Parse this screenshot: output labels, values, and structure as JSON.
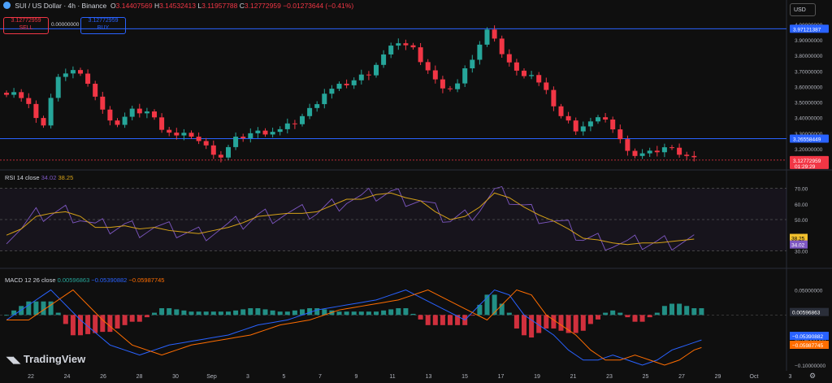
{
  "header": {
    "symbol": "SUI / US Dollar · 4h · Binance",
    "o_label": "O",
    "o_value": "3.14407569",
    "h_label": "H",
    "h_value": "3.14532413",
    "l_label": "L",
    "l_value": "3.11957788",
    "c_label": "C",
    "c_value": "3.12772959",
    "change": "−0.01273644 (−0.41%)"
  },
  "trade": {
    "sell_price": "3.12772959",
    "sell_label": "SELL",
    "spread": "0.00000000",
    "buy_price": "3.12772959",
    "buy_label": "BUY"
  },
  "currency": "USD",
  "rsi": {
    "label": "RSI 14 close",
    "value": "34.02",
    "ma_value": "38.25"
  },
  "macd": {
    "label": "MACD 12 26 close",
    "hist": "0.00596863",
    "macd": "−0.05390882",
    "signal": "−0.05987745"
  },
  "brand": "TradingView",
  "colors": {
    "up": "#26a69a",
    "down": "#f23645",
    "rsi": "#7e57c2",
    "rsi_ma": "#d4a017",
    "macd": "#2962ff",
    "signal": "#ff6d00"
  },
  "chart_data": {
    "type": "candlestick",
    "price_axis": {
      "ticks": [
        "4.00000000",
        "3.90000000",
        "3.80000000",
        "3.70000000",
        "3.60000000",
        "3.50000000",
        "3.40000000",
        "3.30000000",
        "3.20000000"
      ],
      "min": 3.08,
      "max": 4.02
    },
    "price_levels": [
      3.97121387,
      3.26558449
    ],
    "price_badges": [
      {
        "text": "3.97121387",
        "color": "#2962ff"
      },
      {
        "text": "3.26558449",
        "color": "#2962ff"
      },
      {
        "text": "3.12772959",
        "color": "#f23645",
        "sub": "01:29:29"
      }
    ],
    "rsi_axis": {
      "ticks": [
        "70.00",
        "60.00",
        "50.00",
        "40.00",
        "30.00"
      ],
      "min": 25,
      "max": 75,
      "badges": [
        {
          "text": "38.25",
          "color": "#f2c12e"
        },
        {
          "text": "34.02",
          "color": "#7e57c2"
        }
      ]
    },
    "macd_axis": {
      "ticks": [
        "0.05000000",
        "−0.05000000",
        "−0.10000000"
      ],
      "min": -0.105,
      "max": 0.085,
      "badges": [
        {
          "text": "0.00596863",
          "color": "#2a2e39"
        },
        {
          "text": "−0.05390882",
          "color": "#2962ff"
        },
        {
          "text": "−0.05987745",
          "color": "#ff6d00"
        }
      ]
    },
    "x_labels": [
      "22",
      "24",
      "26",
      "28",
      "30",
      "Sep",
      "3",
      "5",
      "7",
      "9",
      "11",
      "13",
      "15",
      "17",
      "19",
      "21",
      "23",
      "25",
      "27",
      "29",
      "Oct",
      "3"
    ],
    "price_path": [
      [
        0,
        3.56
      ],
      [
        2,
        3.57
      ],
      [
        4,
        3.47
      ],
      [
        6,
        3.35
      ],
      [
        8,
        3.68
      ],
      [
        10,
        3.7
      ],
      [
        12,
        3.63
      ],
      [
        14,
        3.44
      ],
      [
        16,
        3.36
      ],
      [
        18,
        3.44
      ],
      [
        20,
        3.44
      ],
      [
        22,
        3.34
      ],
      [
        24,
        3.28
      ],
      [
        26,
        3.29
      ],
      [
        28,
        3.21
      ],
      [
        30,
        3.15
      ],
      [
        32,
        3.26
      ],
      [
        34,
        3.3
      ],
      [
        36,
        3.31
      ],
      [
        38,
        3.32
      ],
      [
        40,
        3.37
      ],
      [
        42,
        3.45
      ],
      [
        44,
        3.56
      ],
      [
        46,
        3.6
      ],
      [
        48,
        3.64
      ],
      [
        50,
        3.69
      ],
      [
        52,
        3.8
      ],
      [
        54,
        3.89
      ],
      [
        56,
        3.84
      ],
      [
        58,
        3.71
      ],
      [
        60,
        3.57
      ],
      [
        62,
        3.62
      ],
      [
        64,
        3.79
      ],
      [
        66,
        3.96
      ],
      [
        68,
        3.82
      ],
      [
        70,
        3.69
      ],
      [
        72,
        3.68
      ],
      [
        74,
        3.56
      ],
      [
        76,
        3.41
      ],
      [
        78,
        3.33
      ],
      [
        80,
        3.37
      ],
      [
        82,
        3.4
      ],
      [
        84,
        3.25
      ],
      [
        86,
        3.16
      ],
      [
        88,
        3.17
      ],
      [
        90,
        3.21
      ],
      [
        92,
        3.18
      ],
      [
        94,
        3.14
      ]
    ],
    "rsi_path": [
      [
        0,
        40
      ],
      [
        2,
        44
      ],
      [
        4,
        52
      ],
      [
        6,
        54
      ],
      [
        8,
        55
      ],
      [
        10,
        52
      ],
      [
        12,
        45
      ],
      [
        14,
        45
      ],
      [
        16,
        46
      ],
      [
        18,
        44
      ],
      [
        20,
        45
      ],
      [
        22,
        43
      ],
      [
        24,
        42
      ],
      [
        26,
        41
      ],
      [
        28,
        43
      ],
      [
        30,
        45
      ],
      [
        32,
        48
      ],
      [
        34,
        52
      ],
      [
        36,
        53
      ],
      [
        38,
        54
      ],
      [
        40,
        54
      ],
      [
        42,
        55
      ],
      [
        44,
        59
      ],
      [
        46,
        63
      ],
      [
        48,
        63
      ],
      [
        50,
        66
      ],
      [
        52,
        67
      ],
      [
        54,
        64
      ],
      [
        56,
        62
      ],
      [
        58,
        55
      ],
      [
        60,
        50
      ],
      [
        62,
        52
      ],
      [
        64,
        58
      ],
      [
        66,
        67
      ],
      [
        68,
        64
      ],
      [
        70,
        58
      ],
      [
        72,
        53
      ],
      [
        74,
        49
      ],
      [
        76,
        44
      ],
      [
        78,
        38
      ],
      [
        80,
        37
      ],
      [
        82,
        35
      ],
      [
        84,
        34
      ],
      [
        86,
        35
      ],
      [
        88,
        35
      ],
      [
        90,
        36
      ],
      [
        92,
        37
      ],
      [
        94,
        38
      ]
    ],
    "macd_path": [
      [
        0,
        -0.01
      ],
      [
        4,
        0.03
      ],
      [
        6,
        0.05
      ],
      [
        10,
        -0.01
      ],
      [
        14,
        -0.06
      ],
      [
        18,
        -0.08
      ],
      [
        22,
        -0.06
      ],
      [
        26,
        -0.05
      ],
      [
        30,
        -0.04
      ],
      [
        34,
        -0.02
      ],
      [
        38,
        -0.01
      ],
      [
        42,
        0.01
      ],
      [
        46,
        0.02
      ],
      [
        50,
        0.03
      ],
      [
        54,
        0.05
      ],
      [
        58,
        0.02
      ],
      [
        62,
        -0.01
      ],
      [
        64,
        0.02
      ],
      [
        66,
        0.05
      ],
      [
        68,
        0.04
      ],
      [
        70,
        0.0
      ],
      [
        72,
        -0.02
      ],
      [
        74,
        -0.04
      ],
      [
        76,
        -0.07
      ],
      [
        78,
        -0.09
      ],
      [
        80,
        -0.09
      ],
      [
        82,
        -0.08
      ],
      [
        84,
        -0.09
      ],
      [
        86,
        -0.1
      ],
      [
        88,
        -0.09
      ],
      [
        90,
        -0.07
      ],
      [
        92,
        -0.06
      ],
      [
        94,
        -0.05
      ]
    ]
  }
}
